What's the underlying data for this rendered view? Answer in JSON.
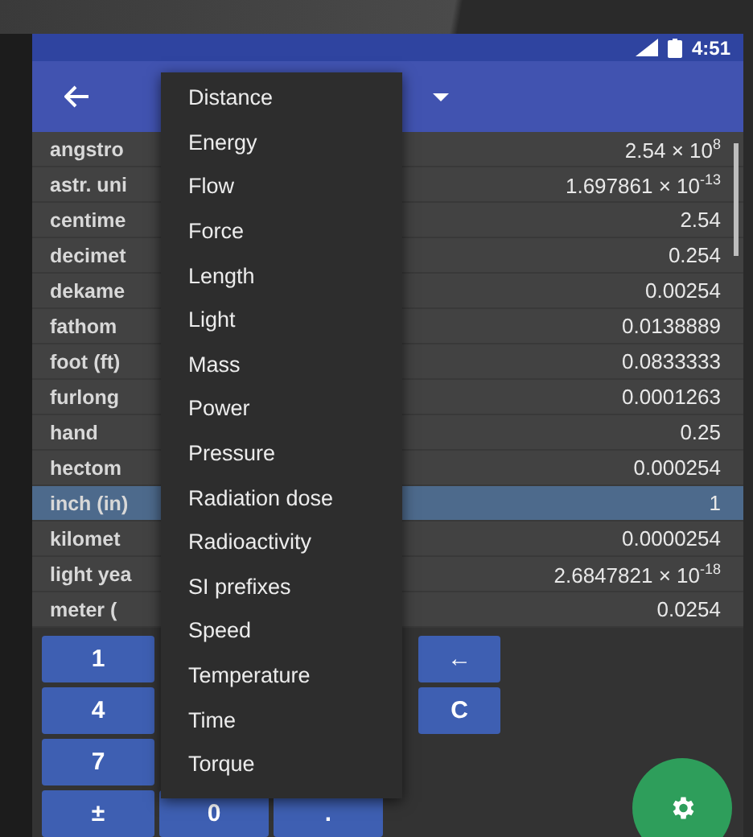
{
  "status_bar": {
    "time": "4:51"
  },
  "units": [
    {
      "name": "angstro",
      "value": "2.54 × 10$^{8}$",
      "selected": false
    },
    {
      "name": "astr. uni",
      "value": "1.697861 × 10$^{-13}$",
      "selected": false
    },
    {
      "name": "centime",
      "value": "2.54",
      "selected": false
    },
    {
      "name": "decimet",
      "value": "0.254",
      "selected": false
    },
    {
      "name": "dekame",
      "value": "0.00254",
      "selected": false
    },
    {
      "name": "fathom",
      "value": "0.0138889",
      "selected": false
    },
    {
      "name": "foot (ft)",
      "value": "0.0833333",
      "selected": false
    },
    {
      "name": "furlong",
      "value": "0.0001263",
      "selected": false
    },
    {
      "name": "hand",
      "value": "0.25",
      "selected": false
    },
    {
      "name": "hectom",
      "value": "0.000254",
      "selected": false
    },
    {
      "name": "inch (in)",
      "value": "1",
      "selected": true
    },
    {
      "name": "kilomet",
      "value": "0.0000254",
      "selected": false
    },
    {
      "name": "light yea",
      "value": "2.6847821 × 10$^{-18}$",
      "selected": false
    },
    {
      "name": "meter (",
      "value": "0.0254",
      "selected": false
    }
  ],
  "keypad": [
    [
      {
        "label": "1",
        "kind": "digit"
      },
      {
        "label": "←",
        "kind": "action"
      }
    ],
    [
      {
        "label": "4",
        "kind": "digit"
      },
      {
        "label": "C",
        "kind": "action"
      }
    ],
    [
      {
        "label": "7",
        "kind": "digit"
      }
    ],
    [
      {
        "label": "±",
        "kind": "digit"
      },
      {
        "label": "0",
        "kind": "digit"
      },
      {
        "label": ".",
        "kind": "digit"
      }
    ]
  ],
  "category_menu": [
    "Distance",
    "Energy",
    "Flow",
    "Force",
    "Length",
    "Light",
    "Mass",
    "Power",
    "Pressure",
    "Radiation dose",
    "Radioactivity",
    "SI prefixes",
    "Speed",
    "Temperature",
    "Time",
    "Torque"
  ]
}
